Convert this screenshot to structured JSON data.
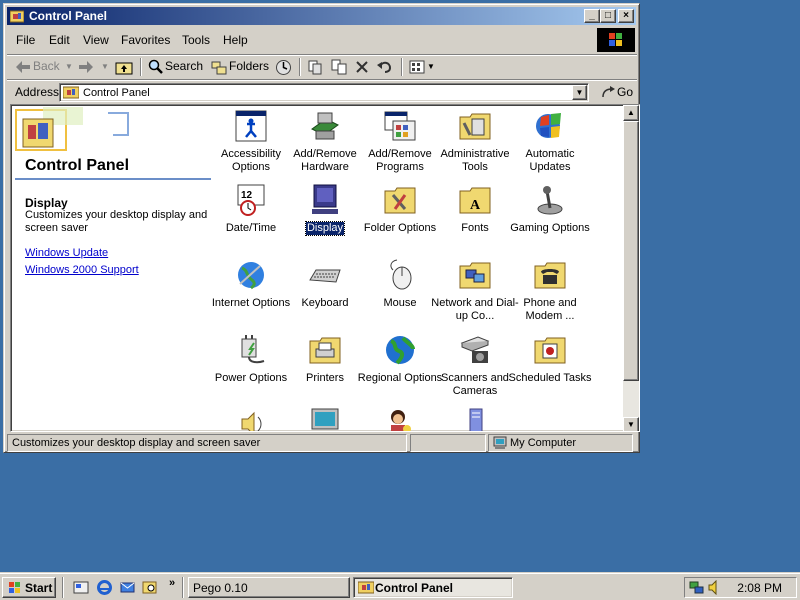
{
  "window": {
    "title": "Control Panel",
    "controls": {
      "minimize": "_",
      "maximize": "□",
      "close": "×"
    }
  },
  "menu": [
    "File",
    "Edit",
    "View",
    "Favorites",
    "Tools",
    "Help"
  ],
  "toolbar": {
    "back": "Back",
    "search": "Search",
    "folders": "Folders"
  },
  "address": {
    "label": "Address",
    "value": "Control Panel",
    "go": "Go"
  },
  "left_pane": {
    "title": "Control Panel",
    "selected_name": "Display",
    "selected_desc": "Customizes your desktop display and screen saver",
    "links": [
      "Windows Update",
      "Windows 2000 Support"
    ]
  },
  "items": [
    {
      "label": "Accessibility Options",
      "icon": "accessibility-icon"
    },
    {
      "label": "Add/Remove Hardware",
      "icon": "hardware-icon"
    },
    {
      "label": "Add/Remove Programs",
      "icon": "programs-icon"
    },
    {
      "label": "Administrative Tools",
      "icon": "admin-tools-icon"
    },
    {
      "label": "Automatic Updates",
      "icon": "windows-update-icon"
    },
    {
      "label": "Date/Time",
      "icon": "calendar-clock-icon"
    },
    {
      "label": "Display",
      "icon": "monitor-icon",
      "selected": true
    },
    {
      "label": "Folder Options",
      "icon": "folder-options-icon"
    },
    {
      "label": "Fonts",
      "icon": "fonts-folder-icon"
    },
    {
      "label": "Gaming Options",
      "icon": "joystick-icon"
    },
    {
      "label": "Internet Options",
      "icon": "globe-icon"
    },
    {
      "label": "Keyboard",
      "icon": "keyboard-icon"
    },
    {
      "label": "Mouse",
      "icon": "mouse-icon"
    },
    {
      "label": "Network and Dial-up Co...",
      "icon": "network-icon"
    },
    {
      "label": "Phone and Modem ...",
      "icon": "phone-icon"
    },
    {
      "label": "Power Options",
      "icon": "power-plug-icon"
    },
    {
      "label": "Printers",
      "icon": "printer-icon"
    },
    {
      "label": "Regional Options",
      "icon": "earth-icon"
    },
    {
      "label": "Scanners and Cameras",
      "icon": "scanner-camera-icon"
    },
    {
      "label": "Scheduled Tasks",
      "icon": "scheduled-tasks-icon"
    },
    {
      "label": "",
      "icon": "speaker-icon"
    },
    {
      "label": "",
      "icon": "computer-icon"
    },
    {
      "label": "",
      "icon": "users-icon"
    },
    {
      "label": "",
      "icon": "wireless-icon"
    }
  ],
  "status": {
    "text": "Customizes your desktop display and screen saver",
    "zone": "My Computer"
  },
  "taskbar": {
    "start": "Start",
    "tasks": [
      "Pego 0.10",
      "Control Panel"
    ],
    "clock": "2:08 PM"
  },
  "colors": {
    "desktop": "#3a6ea5",
    "face": "#d4d0c8",
    "title_active": "#0a246a",
    "selection": "#0a246a"
  }
}
